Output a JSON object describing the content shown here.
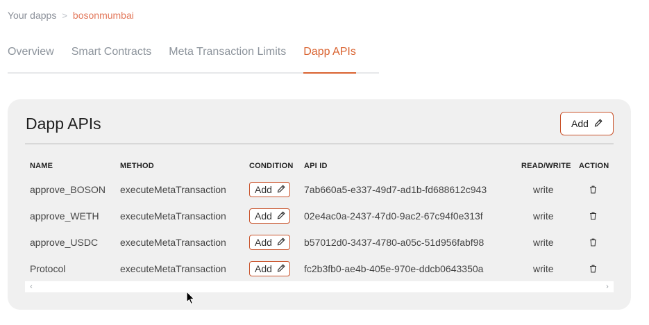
{
  "breadcrumb": {
    "parent": "Your dapps",
    "separator": ">",
    "current": "bosonmumbai"
  },
  "tabs": [
    {
      "label": "Overview",
      "active": false
    },
    {
      "label": "Smart Contracts",
      "active": false
    },
    {
      "label": "Meta Transaction Limits",
      "active": false
    },
    {
      "label": "Dapp APIs",
      "active": true
    }
  ],
  "panel": {
    "title": "Dapp APIs",
    "add_label": "Add"
  },
  "table": {
    "headers": {
      "name": "NAME",
      "method": "METHOD",
      "condition": "CONDITION",
      "api_id": "API ID",
      "read_write": "READ/WRITE",
      "action": "ACTION"
    },
    "rows": [
      {
        "name": "approve_BOSON",
        "method": "executeMetaTransaction",
        "condition": "Add",
        "api_id": "7ab660a5-e337-49d7-ad1b-fd688612c943",
        "read_write": "write"
      },
      {
        "name": "approve_WETH",
        "method": "executeMetaTransaction",
        "condition": "Add",
        "api_id": "02e4ac0a-2437-47d0-9ac2-67c94f0e313f",
        "read_write": "write"
      },
      {
        "name": "approve_USDC",
        "method": "executeMetaTransaction",
        "condition": "Add",
        "api_id": "b57012d0-3437-4780-a05c-51d956fabf98",
        "read_write": "write"
      },
      {
        "name": "Protocol",
        "method": "executeMetaTransaction",
        "condition": "Add",
        "api_id": "fc2b3fb0-ae4b-405e-970e-ddcb0643350a",
        "read_write": "write"
      }
    ]
  },
  "scrollbar": {
    "left_arrow": "‹",
    "right_arrow": "›"
  },
  "icons": {
    "edit": "pencil-icon",
    "delete": "trash-icon",
    "cursor": "mouse-pointer-icon"
  },
  "colors": {
    "accent": "#d9622f",
    "breadcrumb_current": "#e2775a",
    "panel_bg": "#f0f0f0",
    "button_border": "#c9522a"
  }
}
